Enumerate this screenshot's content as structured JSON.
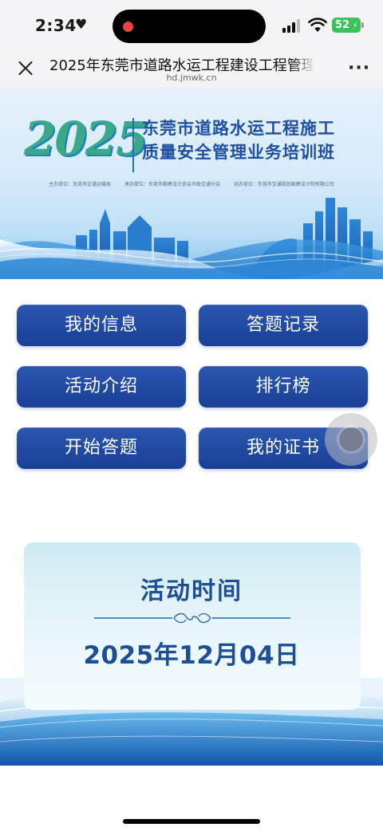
{
  "status_bar": {
    "time": "2:34",
    "battery": "52",
    "icons": [
      "heart-icon",
      "record-dot-icon",
      "cellular-signal-icon",
      "wifi-icon",
      "battery-icon"
    ]
  },
  "browser": {
    "page_title": "2025年东莞市道路水运工程建设工程管理",
    "domain": "hd.jmwk.cn",
    "icons": [
      "close-icon",
      "more-icon"
    ]
  },
  "banner": {
    "year": "2025",
    "title_line1": "东莞市道路水运工程施工",
    "title_line2": "质量安全管理业务培训班",
    "sponsors": "主办单位：东莞市交通运输局 　　承办单位：东莞市勘察设计协会市政交通分会 　　协办单位：东莞市交通规划勘察设计院有限公司"
  },
  "menu": {
    "my_info": "我的信息",
    "answer_records": "答题记录",
    "activity_intro": "活动介绍",
    "leaderboard": "排行榜",
    "start_quiz": "开始答题",
    "my_certificate": "我的证书"
  },
  "activity": {
    "title": "活动时间",
    "date": "2025年12月04日"
  },
  "colors": {
    "button": "#1f4a9f",
    "card_text": "#1d4f95",
    "year_green": "#3aa98a",
    "banner_title": "#1f4fa0",
    "battery": "#38c45a"
  }
}
